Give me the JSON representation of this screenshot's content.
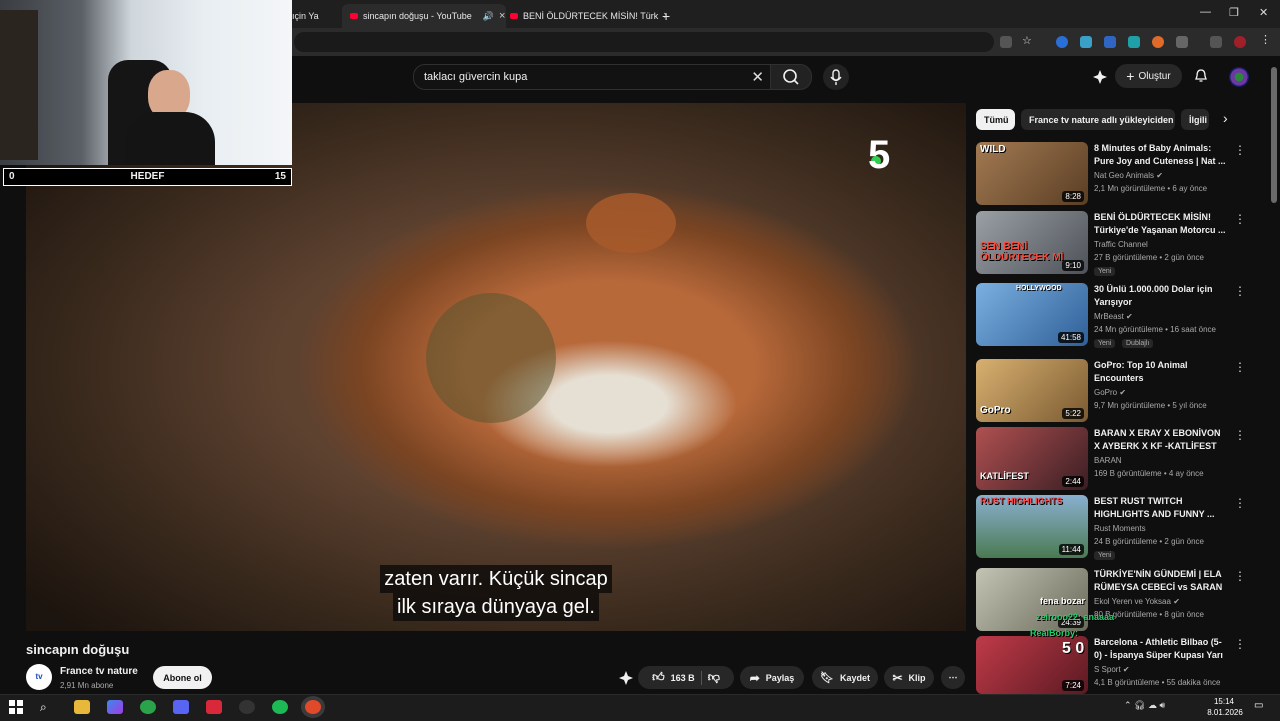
{
  "browser": {
    "tabs": [
      {
        "title": "ıçin Ya"
      },
      {
        "title": "sincapın doğuşu - YouTube",
        "active": true
      },
      {
        "title": "BENİ ÖLDÜRTECEK MİSİN! Türk"
      }
    ],
    "new_tab": "+"
  },
  "masthead": {
    "search_query": "taklacı güvercin kupa",
    "create_label": "Oluştur"
  },
  "overlay": {
    "goal_left": "0",
    "goal_label": "HEDEF",
    "goal_right": "15"
  },
  "player": {
    "channel_logo": "5",
    "subtitle_line1": "zaten varır. Küçük sincap",
    "subtitle_line2": "ilk sıraya dünyaya gel."
  },
  "video": {
    "title": "sincapın doğuşu",
    "channel": "France tv nature",
    "channel_avatar_text": "tv",
    "subscribers": "2,91 Mn abone",
    "subscribe_label": "Abone ol",
    "likes": "163 B",
    "share_label": "Paylaş",
    "save_label": "Kaydet",
    "clip_label": "Klip",
    "more_label": "⋯"
  },
  "chips": [
    {
      "label": "Tümü"
    },
    {
      "label": "France tv nature adlı yükleyiciden"
    },
    {
      "label": "İlgili"
    }
  ],
  "recommendations": [
    {
      "title": "8 Minutes of Baby Animals: Pure Joy and Cuteness | Nat ...",
      "channel": "Nat Geo Animals",
      "verified": true,
      "meta": "2,1 Mn görüntüleme • 6 ay önce",
      "duration": "8:28",
      "thumb_text": "WILD",
      "badge": "",
      "color": "#8a6a4a"
    },
    {
      "title": "BENİ ÖLDÜRTECEK MİSİN! Türkiye'de Yaşanan Motorcu ...",
      "channel": "Traffic Channel",
      "verified": false,
      "meta": "27 B görüntüleme • 2 gün önce",
      "duration": "9:10",
      "thumb_text": "SEN BENİ ÖLDÜRTECEK Mİ",
      "badge": "Yeni",
      "color": "#7c7c84"
    },
    {
      "title": "30 Ünlü 1.000.000 Dolar için Yarışıyor",
      "channel": "MrBeast",
      "verified": true,
      "meta": "24 Mn görüntüleme • 16 saat önce",
      "duration": "41:58",
      "thumb_text": "HOLLYWOOD",
      "badge": "Yeni",
      "badge2": "Dublajlı",
      "color": "#5b8fc4"
    },
    {
      "title": "GoPro: Top 10 Animal Encounters",
      "channel": "GoPro",
      "verified": true,
      "meta": "9,7 Mn görüntüleme • 5 yıl önce",
      "duration": "5:22",
      "thumb_text": "GoPro",
      "badge": "",
      "color": "#b38a4e"
    },
    {
      "title": "BARAN X ERAY X EBONİVON X AYBERK X KF -KATLİFEST ...",
      "channel": "BARAN",
      "verified": false,
      "meta": "169 B görüntüleme • 4 ay önce",
      "duration": "2:44",
      "thumb_text": "KATLİFEST",
      "badge": "",
      "color": "#8a3b3b"
    },
    {
      "title": "BEST RUST TWITCH HIGHLIGHTS AND FUNNY ...",
      "channel": "Rust Moments",
      "verified": false,
      "meta": "24 B görüntüleme • 2 gün önce",
      "duration": "11:44",
      "thumb_text": "RUST HIGHLIGHTS",
      "badge": "Yeni",
      "color": "#5f8a6a"
    },
    {
      "title": "TÜRKİYE'NİN GÜNDEMİ | ELA RÜMEYSA CEBECİ vs SARAN",
      "channel": "Ekol Yeren ve Yoksaa",
      "verified": true,
      "meta": "80 B görüntüleme • 8 gün önce",
      "duration": "24:39",
      "thumb_text": "",
      "badge": "",
      "color": "#9a9a8a"
    },
    {
      "title": "Barcelona - Athletic Bilbao (5-0) - İspanya Süper Kupası Yarı ...",
      "channel": "S Sport",
      "verified": true,
      "meta": "4,1 B görüntüleme • 55 dakika önce",
      "duration": "7:24",
      "thumb_text": "5 0",
      "badge": "",
      "color": "#a82a3a"
    }
  ],
  "chat_overlay": [
    {
      "text": "fena bozar",
      "color": "#ffffff"
    },
    {
      "text": "zeirooo22: anaaaa",
      "color": "#22d36a"
    },
    {
      "text": "RealBorby:",
      "color": "#22d36a"
    }
  ],
  "taskbar": {
    "time": "15:14",
    "date": "8.01.2026"
  }
}
